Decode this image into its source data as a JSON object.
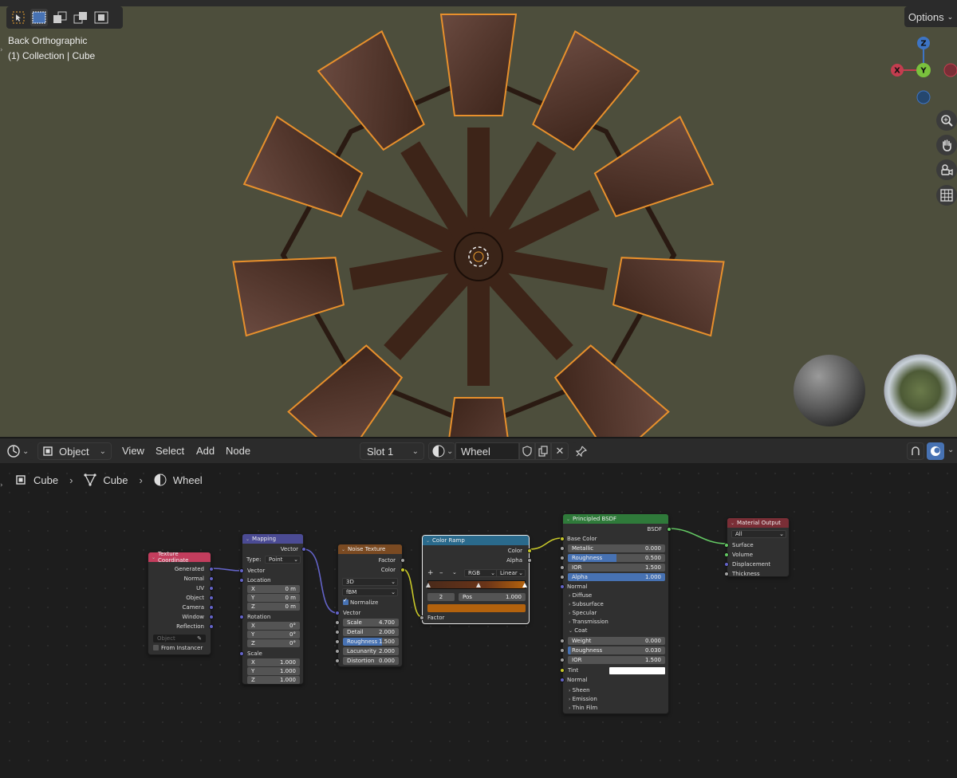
{
  "viewport": {
    "view_name": "Back Orthographic",
    "collection_info": "(1) Collection | Cube",
    "options_label": "Options",
    "gizmo": {
      "z": "Z",
      "x": "X",
      "y": "Y"
    }
  },
  "node_header": {
    "mode": "Object",
    "menus": [
      "View",
      "Select",
      "Add",
      "Node"
    ],
    "slot": "Slot 1",
    "material": "Wheel"
  },
  "breadcrumb": [
    "Cube",
    "Cube",
    "Wheel"
  ],
  "nodes": {
    "texcoord": {
      "title": "Texture Coordinate",
      "outputs": [
        "Generated",
        "Normal",
        "UV",
        "Object",
        "Camera",
        "Window",
        "Reflection"
      ],
      "object_placeholder": "Object",
      "from_instancer": "From Instancer"
    },
    "mapping": {
      "title": "Mapping",
      "output": "Vector",
      "type_label": "Type:",
      "type_value": "Point",
      "vector_in": "Vector",
      "location": {
        "label": "Location",
        "x": "0 m",
        "y": "0 m",
        "z": "0 m"
      },
      "rotation": {
        "label": "Rotation",
        "x": "0°",
        "y": "0°",
        "z": "0°"
      },
      "scale": {
        "label": "Scale",
        "x": "1.000",
        "y": "1.000",
        "z": "1.000"
      },
      "axis": [
        "X",
        "Y",
        "Z"
      ]
    },
    "noise": {
      "title": "Noise Texture",
      "outputs": [
        "Factor",
        "Color"
      ],
      "dim": "3D",
      "type": "fBM",
      "normalize": "Normalize",
      "vector_in": "Vector",
      "fields": [
        {
          "label": "Scale",
          "value": "4.700"
        },
        {
          "label": "Detail",
          "value": "2.000"
        },
        {
          "label": "Roughness",
          "value": "1.500"
        },
        {
          "label": "Lacunarity",
          "value": "2.000"
        },
        {
          "label": "Distortion",
          "value": "0.000"
        }
      ]
    },
    "ramp": {
      "title": "Color Ramp",
      "outputs": [
        "Color",
        "Alpha"
      ],
      "mode": "RGB",
      "interp": "Linear",
      "index": "2",
      "pos_label": "Pos",
      "pos_value": "1.000",
      "factor_in": "Factor",
      "plus": "+",
      "minus": "–",
      "menu_caret": "⌄"
    },
    "bsdf": {
      "title": "Principled BSDF",
      "output": "BSDF",
      "base_color": "Base Color",
      "fields": [
        {
          "label": "Metallic",
          "value": "0.000"
        },
        {
          "label": "Roughness",
          "value": "0.500"
        },
        {
          "label": "IOR",
          "value": "1.500"
        },
        {
          "label": "Alpha",
          "value": "1.000"
        }
      ],
      "normal": "Normal",
      "panels": [
        "Diffuse",
        "Subsurface",
        "Specular",
        "Transmission"
      ],
      "coat": "Coat",
      "coat_fields": [
        {
          "label": "Weight",
          "value": "0.000"
        },
        {
          "label": "Roughness",
          "value": "0.030"
        },
        {
          "label": "IOR",
          "value": "1.500"
        }
      ],
      "tint": "Tint",
      "coat_normal": "Normal",
      "panels2": [
        "Sheen",
        "Emission",
        "Thin Film"
      ]
    },
    "output": {
      "title": "Material Output",
      "target": "All",
      "inputs": [
        "Surface",
        "Volume",
        "Displacement",
        "Thickness"
      ]
    }
  },
  "colors": {
    "viewport_bg": "#4d4e3c",
    "header_input": "#c33d5d",
    "header_vector": "#4b4b94",
    "header_texture": "#7a4a22",
    "header_converter": "#2a6a8c",
    "header_shader": "#2f7a3a",
    "header_output": "#7a2e36",
    "accent_blue": "#4772b3",
    "ramp_color": "#b3620d"
  }
}
